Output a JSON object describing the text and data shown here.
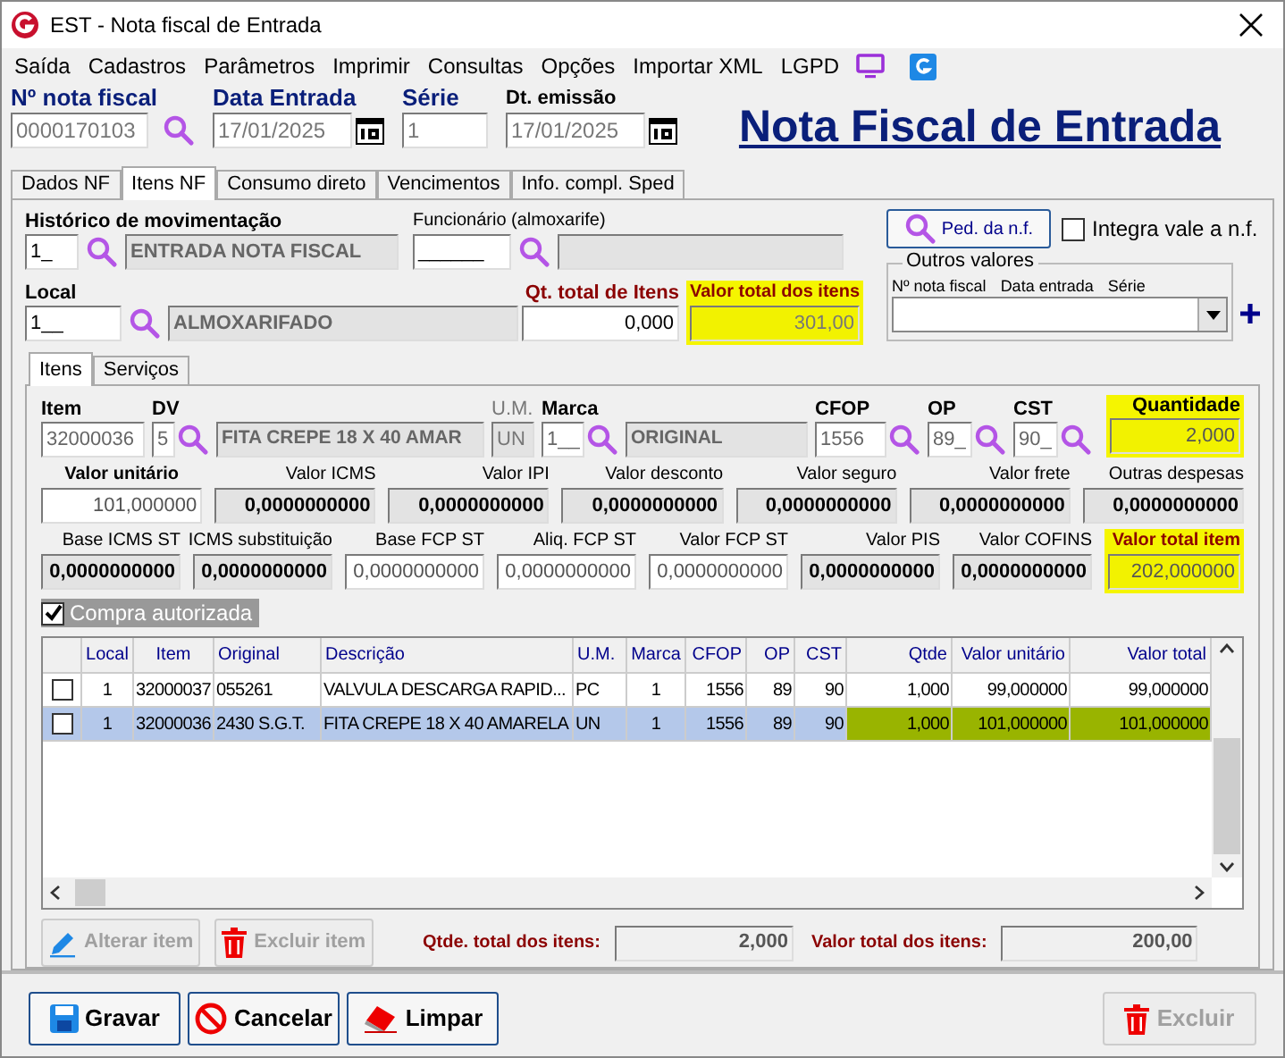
{
  "window": {
    "title": "EST - Nota fiscal de Entrada"
  },
  "menu": [
    "Saída",
    "Cadastros",
    "Parâmetros",
    "Imprimir",
    "Consultas",
    "Opções",
    "Importar XML",
    "LGPD"
  ],
  "header": {
    "fields": [
      {
        "label": "Nº nota fiscal",
        "value": "0000170103",
        "kind": "search"
      },
      {
        "label": "Data Entrada",
        "value": "17/01/2025",
        "kind": "date"
      },
      {
        "label": "Série",
        "value": "1",
        "kind": "plain"
      },
      {
        "label": "Dt. emissão",
        "value": "17/01/2025",
        "kind": "date"
      }
    ],
    "page_title": "Nota Fiscal de Entrada"
  },
  "tabs": [
    {
      "label": "Dados NF",
      "selected": false
    },
    {
      "label": "Itens NF",
      "selected": true
    },
    {
      "label": "Consumo direto",
      "selected": false
    },
    {
      "label": "Vencimentos",
      "selected": false
    },
    {
      "label": "Info. compl. Sped",
      "selected": false
    }
  ],
  "history": {
    "label": "Histórico de movimentação",
    "code": "1_",
    "description": "ENTRADA NOTA FISCAL"
  },
  "employee": {
    "label": "Funcionário (almoxarife)",
    "code": "______"
  },
  "order_button": "Ped. da n.f.",
  "integra": {
    "label": "Integra vale a n.f.",
    "checked": false
  },
  "local": {
    "label": "Local",
    "code": "1__",
    "description": "ALMOXARIFADO"
  },
  "qt_total": {
    "label": "Qt. total de Itens",
    "value": "0,000"
  },
  "value_total": {
    "label": "Valor total dos itens",
    "value": "301,00",
    "highlighted": true
  },
  "other_values": {
    "legend": "Outros valores",
    "columns": [
      "Nº nota fiscal",
      "Data entrada",
      "Série"
    ]
  },
  "subtabs": [
    {
      "label": "Itens",
      "selected": true
    },
    {
      "label": "Serviços",
      "selected": false
    }
  ],
  "item_rows": [
    [
      {
        "label": "Item",
        "value": "32000036",
        "kind": "input"
      },
      {
        "label": "DV",
        "value": "5",
        "kind": "input",
        "search": true
      },
      {
        "value": "FITA CREPE 18 X 40 AMAR",
        "kind": "readonly"
      },
      {
        "label": "U.M.",
        "value": "UN",
        "kind": "readonly"
      },
      {
        "label": "Marca",
        "value": "1__",
        "kind": "input",
        "search": true
      },
      {
        "value": "ORIGINAL",
        "kind": "readonly"
      },
      {
        "label": "CFOP",
        "value": "1556",
        "kind": "input",
        "search": true
      },
      {
        "label": "OP",
        "value": "89_",
        "kind": "input",
        "search": true
      },
      {
        "label": "CST",
        "value": "90_",
        "kind": "input",
        "search": true
      },
      {
        "label": "Quantidade",
        "value": "2,000",
        "kind": "highlight"
      }
    ],
    [
      {
        "label": "Valor unitário",
        "value": "101,000000",
        "kind": "input"
      },
      {
        "label": "Valor ICMS",
        "value": "0,0000000000",
        "kind": "readonly"
      },
      {
        "label": "Valor IPI",
        "value": "0,0000000000",
        "kind": "readonly"
      },
      {
        "label": "Valor desconto",
        "value": "0,0000000000",
        "kind": "readonly"
      },
      {
        "label": "Valor seguro",
        "value": "0,0000000000",
        "kind": "readonly"
      },
      {
        "label": "Valor frete",
        "value": "0,0000000000",
        "kind": "readonly"
      },
      {
        "label": "Outras despesas",
        "value": "0,0000000000",
        "kind": "readonly"
      }
    ],
    [
      {
        "label": "Base ICMS ST",
        "value": "0,0000000000",
        "kind": "readonly"
      },
      {
        "label": "ICMS substituição",
        "value": "0,0000000000",
        "kind": "readonly"
      },
      {
        "label": "Base FCP ST",
        "value": "0,0000000000",
        "kind": "input"
      },
      {
        "label": "Aliq. FCP ST",
        "value": "0,0000000000",
        "kind": "input"
      },
      {
        "label": "Valor FCP ST",
        "value": "0,0000000000",
        "kind": "input"
      },
      {
        "label": "Valor PIS",
        "value": "0,0000000000",
        "kind": "readonly"
      },
      {
        "label": "Valor COFINS",
        "value": "0,0000000000",
        "kind": "readonly"
      },
      {
        "label": "Valor total item",
        "value": "202,000000",
        "kind": "highlight"
      }
    ]
  ],
  "compra_autorizada": {
    "label": "Compra autorizada",
    "checked": true
  },
  "table": {
    "columns": [
      "Local",
      "Item",
      "Original",
      "Descrição",
      "U.M.",
      "Marca",
      "CFOP",
      "OP",
      "CST",
      "Qtde",
      "Valor unitário",
      "Valor total"
    ],
    "rows": [
      {
        "checked": false,
        "selected": false,
        "highlighted": false,
        "cells": [
          "1",
          "32000037",
          "055261",
          "VALVULA DESCARGA RAPID...",
          "PC",
          "1",
          "1556",
          "89",
          "90",
          "1,000",
          "99,000000",
          "99,000000"
        ]
      },
      {
        "checked": false,
        "selected": true,
        "highlighted": true,
        "cells": [
          "1",
          "32000036",
          "2430 S.G.T.",
          "FITA CREPE 18 X 40 AMARELA",
          "UN",
          "1",
          "1556",
          "89",
          "90",
          "1,000",
          "101,000000",
          "101,000000"
        ]
      }
    ]
  },
  "item_buttons": [
    {
      "label": "Alterar item",
      "kind": "edit",
      "disabled": true
    },
    {
      "label": "Excluir item",
      "kind": "delete",
      "disabled": true
    }
  ],
  "totals": [
    {
      "label": "Qtde. total dos itens:",
      "value": "2,000"
    },
    {
      "label": "Valor total dos itens:",
      "value": "200,00"
    }
  ],
  "actions": [
    {
      "label": "Gravar",
      "kind": "save",
      "disabled": false
    },
    {
      "label": "Cancelar",
      "kind": "cancel",
      "disabled": false
    },
    {
      "label": "Limpar",
      "kind": "clear",
      "disabled": false
    },
    {
      "label": "Excluir",
      "kind": "delete",
      "disabled": true
    }
  ]
}
